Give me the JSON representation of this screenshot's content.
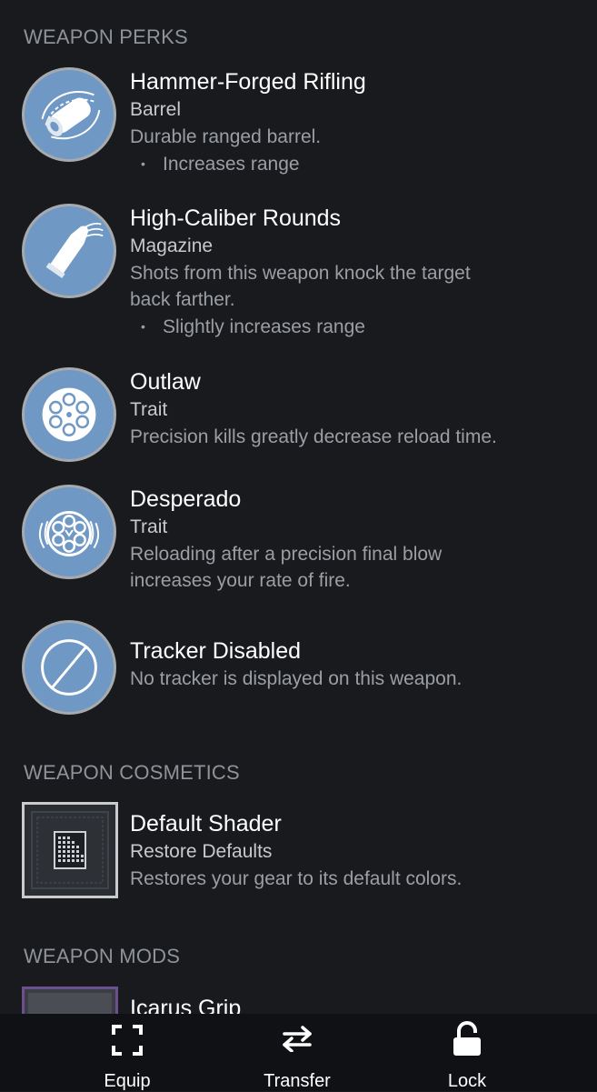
{
  "sections": {
    "perks_header": "WEAPON PERKS",
    "cosmetics_header": "WEAPON COSMETICS",
    "mods_header": "WEAPON MODS"
  },
  "perks": [
    {
      "name": "Hammer-Forged Rifling",
      "type": "Barrel",
      "description": "Durable ranged barrel.",
      "bullet": "Increases range",
      "icon": "barrel-icon"
    },
    {
      "name": "High-Caliber Rounds",
      "type": "Magazine",
      "description_line1": "Shots from this weapon knock the target",
      "description_line2": "back farther.",
      "bullet": "Slightly increases range",
      "icon": "bullet-icon"
    },
    {
      "name": "Outlaw",
      "type": "Trait",
      "description": "Precision kills greatly decrease reload time.",
      "icon": "revolver-cylinder-icon"
    },
    {
      "name": "Desperado",
      "type": "Trait",
      "description_line1": "Reloading after a precision final blow",
      "description_line2": "increases your rate of fire.",
      "icon": "revolver-cylinder-spin-icon"
    },
    {
      "name": "Tracker Disabled",
      "description": "No tracker is displayed on this weapon.",
      "icon": "tracker-disabled-icon"
    }
  ],
  "cosmetics": [
    {
      "name": "Default Shader",
      "type": "Restore Defaults",
      "description": "Restores your gear to its default colors.",
      "icon": "shader-icon"
    }
  ],
  "mods": [
    {
      "name": "Icarus Grip",
      "icon": "mod-icon"
    }
  ],
  "bottom_bar": {
    "equip": "Equip",
    "transfer": "Transfer",
    "lock": "Lock"
  },
  "colors": {
    "background": "#181a1e",
    "perk_icon_fill": "#6f98c5",
    "bottom_bar": "#0f1114"
  }
}
